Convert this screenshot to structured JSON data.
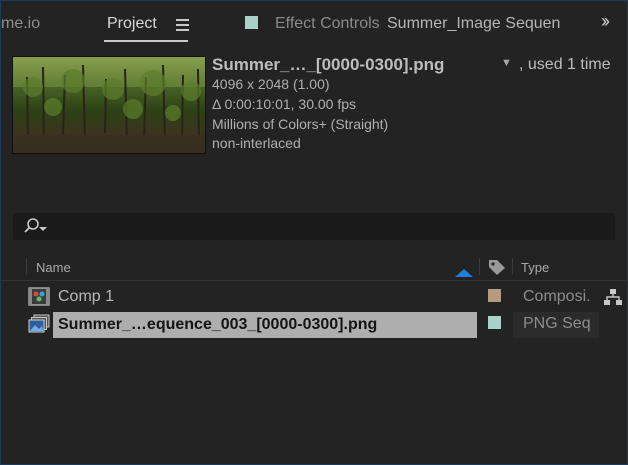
{
  "tabs": {
    "prev_tab_label": "me.io",
    "project_label": "Project",
    "effect_controls_label": "Effect Controls",
    "effect_controls_target": "Summer_Image Sequen"
  },
  "info": {
    "name": "Summer_…_[0000-0300].png",
    "used": ", used 1 time",
    "dimensions": "4096 x 2048 (1.00)",
    "duration": "Δ 0:00:10:01, 30.00 fps",
    "color": "Millions of Colors+ (Straight)",
    "interlace": "non-interlaced"
  },
  "search": {
    "placeholder": ""
  },
  "columns": {
    "name": "Name",
    "type": "Type"
  },
  "items": [
    {
      "name": "Comp 1",
      "type": "Composi.",
      "label_color": "#b49a80",
      "icon": "composition-icon"
    },
    {
      "name": "Summer_…equence_003_[0000-0300].png",
      "type": "PNG Seq",
      "label_color": "#a9d3c8",
      "icon": "image-sequence-icon"
    }
  ],
  "colors": {
    "accent": "#1f7fe0",
    "selection": "#aeaeae",
    "panel_bg": "#232323"
  }
}
